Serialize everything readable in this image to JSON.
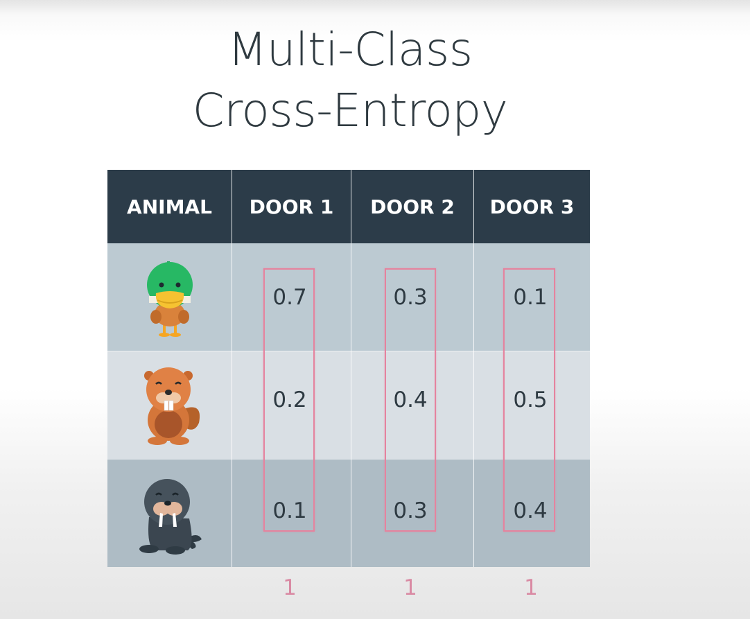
{
  "title": {
    "line1": "Multi-Class",
    "line2": "Cross-Entropy"
  },
  "table": {
    "headers": [
      "ANIMAL",
      "DOOR 1",
      "DOOR 2",
      "DOOR 3"
    ],
    "rows": [
      {
        "animal": "duck-icon",
        "values": [
          "0.7",
          "0.3",
          "0.1"
        ]
      },
      {
        "animal": "beaver-icon",
        "values": [
          "0.2",
          "0.4",
          "0.5"
        ]
      },
      {
        "animal": "walrus-icon",
        "values": [
          "0.1",
          "0.3",
          "0.4"
        ]
      }
    ],
    "column_sums": [
      "1",
      "1",
      "1"
    ]
  },
  "colors": {
    "header_bg": "#2c3c49",
    "row1_bg": "#bccad2",
    "row2_bg": "#d9dfe4",
    "row3_bg": "#aebcc5",
    "highlight": "#e5839e",
    "sum_text": "#d98aa3"
  }
}
